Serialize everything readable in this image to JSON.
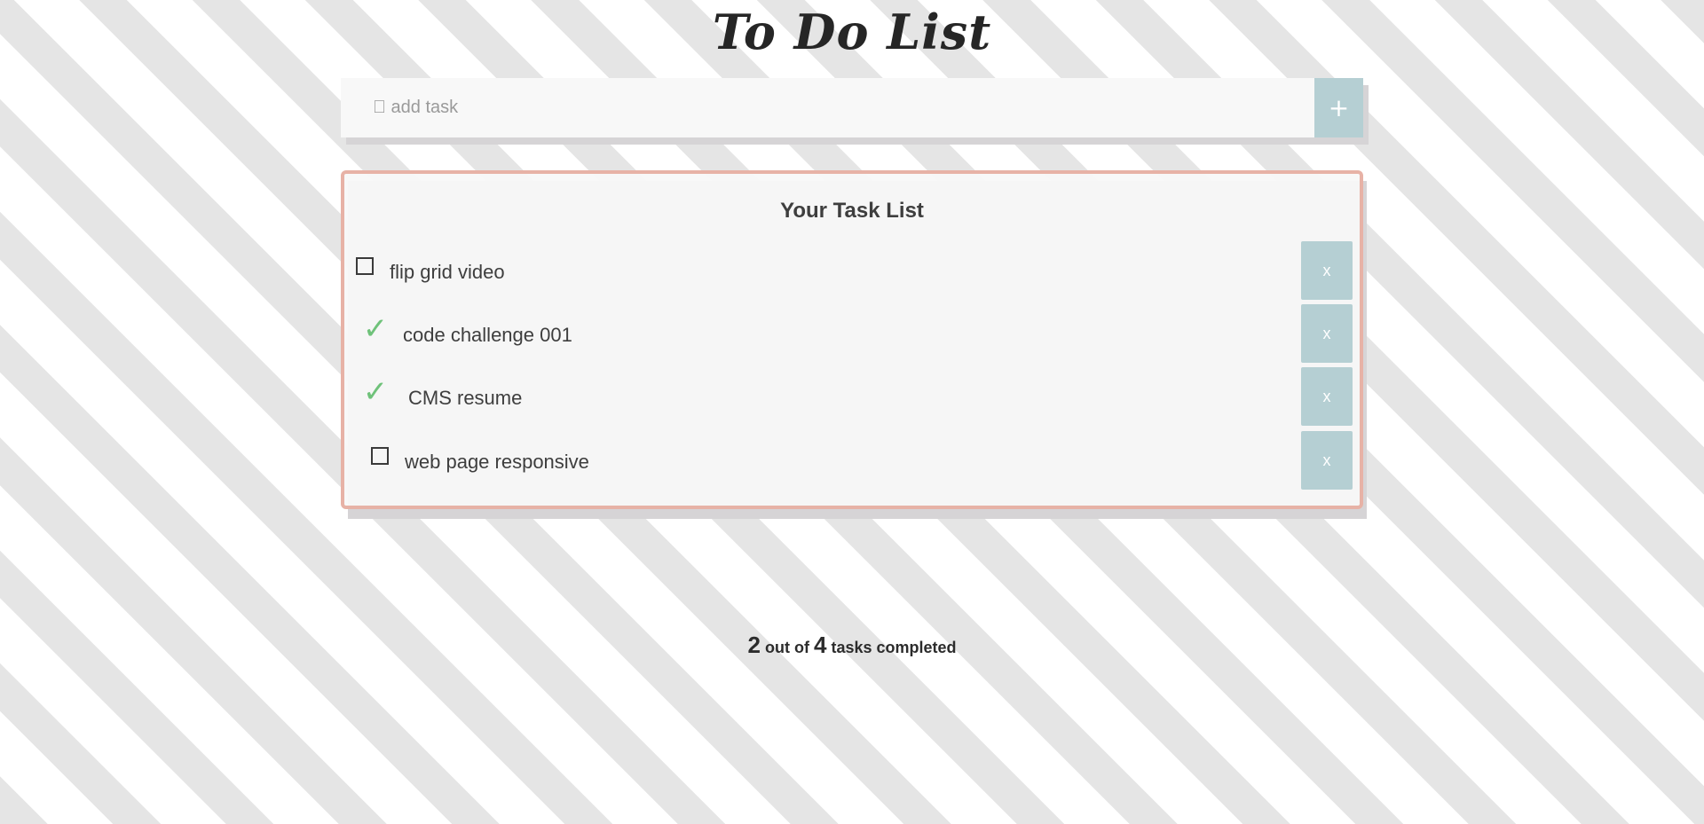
{
  "app": {
    "title": "To Do List"
  },
  "add_task": {
    "placeholder": " add task",
    "button_label": "+"
  },
  "task_list": {
    "heading": "Your Task List",
    "delete_label": "x",
    "tasks": [
      {
        "text": "flip grid video",
        "completed": false
      },
      {
        "text": "code challenge 001",
        "completed": true
      },
      {
        "text": "CMS resume",
        "completed": true
      },
      {
        "text": "web page responsive",
        "completed": false
      }
    ]
  },
  "summary": {
    "completed": "2",
    "middle": "out of",
    "total": "4",
    "suffix": "tasks completed"
  },
  "colors": {
    "accent": "#b5cfd3",
    "panel_border": "#e7b2a6",
    "check": "#6fc27a"
  },
  "icons": {
    "completed": "checkmark-icon",
    "pending": "empty-checkbox-icon",
    "add": "plus-icon",
    "delete": "close-icon"
  }
}
